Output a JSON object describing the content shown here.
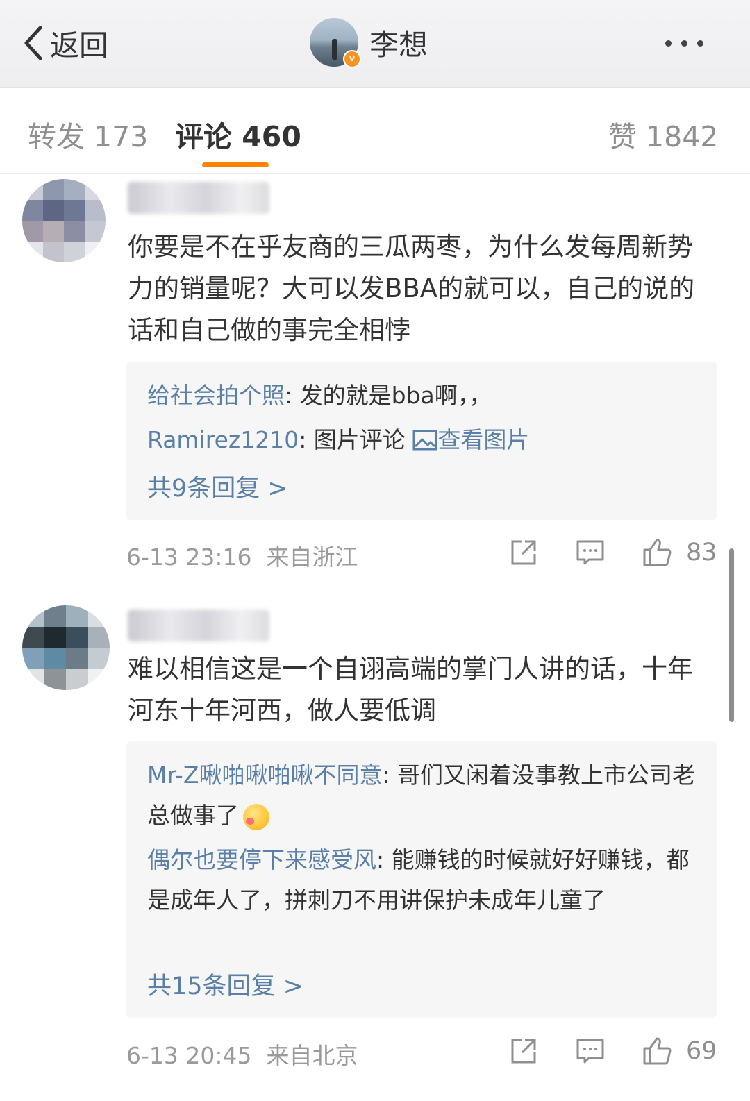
{
  "header": {
    "back_label": "返回",
    "author_name": "李想",
    "verified_badge": "v"
  },
  "tabs": [
    {
      "label": "转发 173"
    },
    {
      "label": "评论 460"
    },
    {
      "label": "赞 1842"
    }
  ],
  "comments": [
    {
      "text": "你要是不在乎友商的三瓜两枣，为什么发每周新势力的销量呢？大可以发BBA的就可以，自己的说的话和自己做的事完全相悖",
      "replies": [
        {
          "name": "给社会拍个照",
          "text": ": 发的就是bba啊，，"
        },
        {
          "name": "Ramirez1210",
          "text": ": 图片评论 ",
          "view_image": "查看图片"
        }
      ],
      "more_replies": "共9条回复 >",
      "time": "6-13 23:16",
      "location": "来自浙江",
      "likes": "83"
    },
    {
      "text": "难以相信这是一个自诩高端的掌门人讲的话，十年河东十年河西，做人要低调",
      "replies": [
        {
          "name": "Mr-Z啾啪啾啪啾不同意",
          "text": ": 哥们又闲着没事教上市公司老总做事了"
        },
        {
          "name": "偶尔也要停下来感受风",
          "text": ": 能赚钱的时候就好好赚钱，都是成年人了，拼刺刀不用讲保护未成年儿童了"
        }
      ],
      "more_replies": "共15条回复 >",
      "time": "6-13 20:45",
      "location": "来自北京",
      "likes": "69"
    }
  ]
}
